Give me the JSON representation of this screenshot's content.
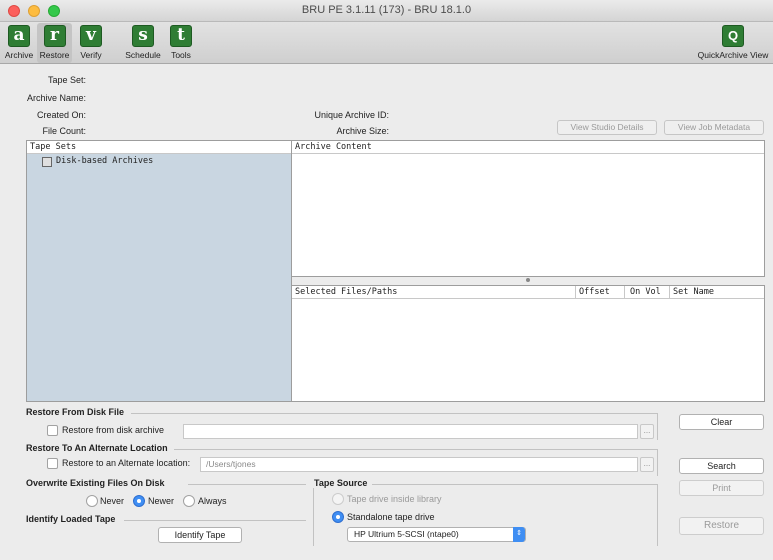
{
  "window": {
    "title": "BRU PE 3.1.11 (173) - BRU 18.1.0"
  },
  "toolbar": {
    "archive": {
      "glyph": "a",
      "label": "Archive"
    },
    "restore": {
      "glyph": "r",
      "label": "Restore"
    },
    "verify": {
      "glyph": "v",
      "label": "Verify"
    },
    "schedule": {
      "glyph": "s",
      "label": "Schedule"
    },
    "tools": {
      "glyph": "t",
      "label": "Tools"
    },
    "quickarchive": {
      "glyph": "Q",
      "label": "QuickArchive View"
    },
    "icon_color": "#2f7d34"
  },
  "info": {
    "tape_set_label": "Tape Set:",
    "archive_name_label": "Archive Name:",
    "created_on_label": "Created On:",
    "file_count_label": "File Count:",
    "unique_id_label": "Unique Archive ID:",
    "archive_size_label": "Archive Size:",
    "view_studio_details": "View Studio Details",
    "view_job_metadata": "View Job Metadata"
  },
  "tape_sets": {
    "header": "Tape Sets",
    "items": [
      {
        "label": "Disk-based Archives",
        "icon": "disk-archive-icon"
      }
    ],
    "background": "#c9d6e1"
  },
  "archive_content": {
    "header": "Archive Content"
  },
  "selected_files": {
    "columns": [
      "Selected Files/Paths",
      "Offset",
      "On Vol",
      "Set Name"
    ]
  },
  "restore_from_disk": {
    "section": "Restore From Disk File",
    "checkbox_label": "Restore from disk archive",
    "path": "",
    "browse": "..."
  },
  "restore_alternate": {
    "section": "Restore To An Alternate Location",
    "checkbox_label": "Restore to an Alternate location:",
    "path_placeholder": "/Users/tjones",
    "browse": "..."
  },
  "overwrite": {
    "section": "Overwrite Existing Files On Disk",
    "options": [
      "Never",
      "Newer",
      "Always"
    ],
    "selected": "Newer"
  },
  "identify": {
    "section": "Identify Loaded Tape",
    "button": "Identify Tape"
  },
  "tape_source": {
    "section": "Tape Source",
    "options": [
      "Tape drive inside library",
      "Standalone tape drive"
    ],
    "selected": "Standalone tape drive",
    "drive": "HP Ultrium 5-SCSI (ntape0)"
  },
  "actions": {
    "clear": "Clear",
    "search": "Search",
    "print": "Print",
    "restore": "Restore"
  },
  "accent_color": "#3f8ef3"
}
